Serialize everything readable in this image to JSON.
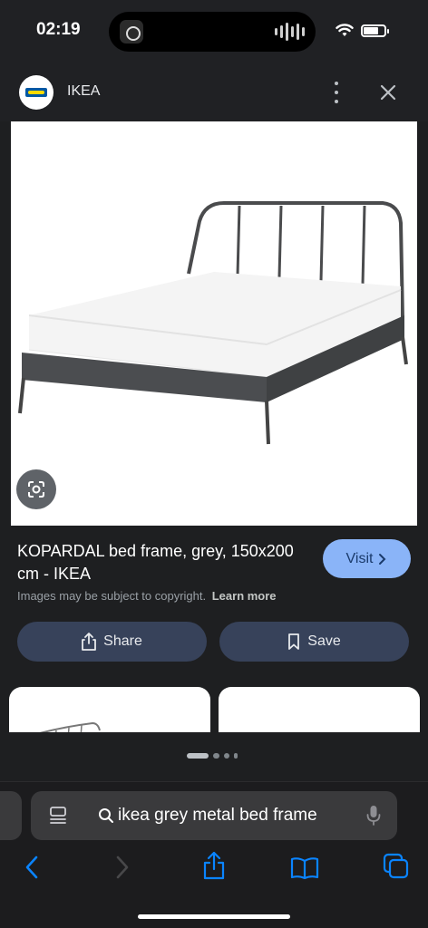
{
  "status_bar": {
    "time": "02:19"
  },
  "site": {
    "name": "IKEA"
  },
  "result": {
    "title": "KOPARDAL bed frame, grey, 150x200 cm - IKEA",
    "visit_label": "Visit",
    "copyright": "Images may be subject to copyright.",
    "learn_more": "Learn more"
  },
  "actions": {
    "share_label": "Share",
    "save_label": "Save"
  },
  "browser": {
    "search_query": "ikea grey metal bed frame"
  },
  "colors": {
    "accent": "#8ab4f8",
    "action_button": "#37425a",
    "background": "#202124",
    "safari_blue": "#0a84ff"
  }
}
